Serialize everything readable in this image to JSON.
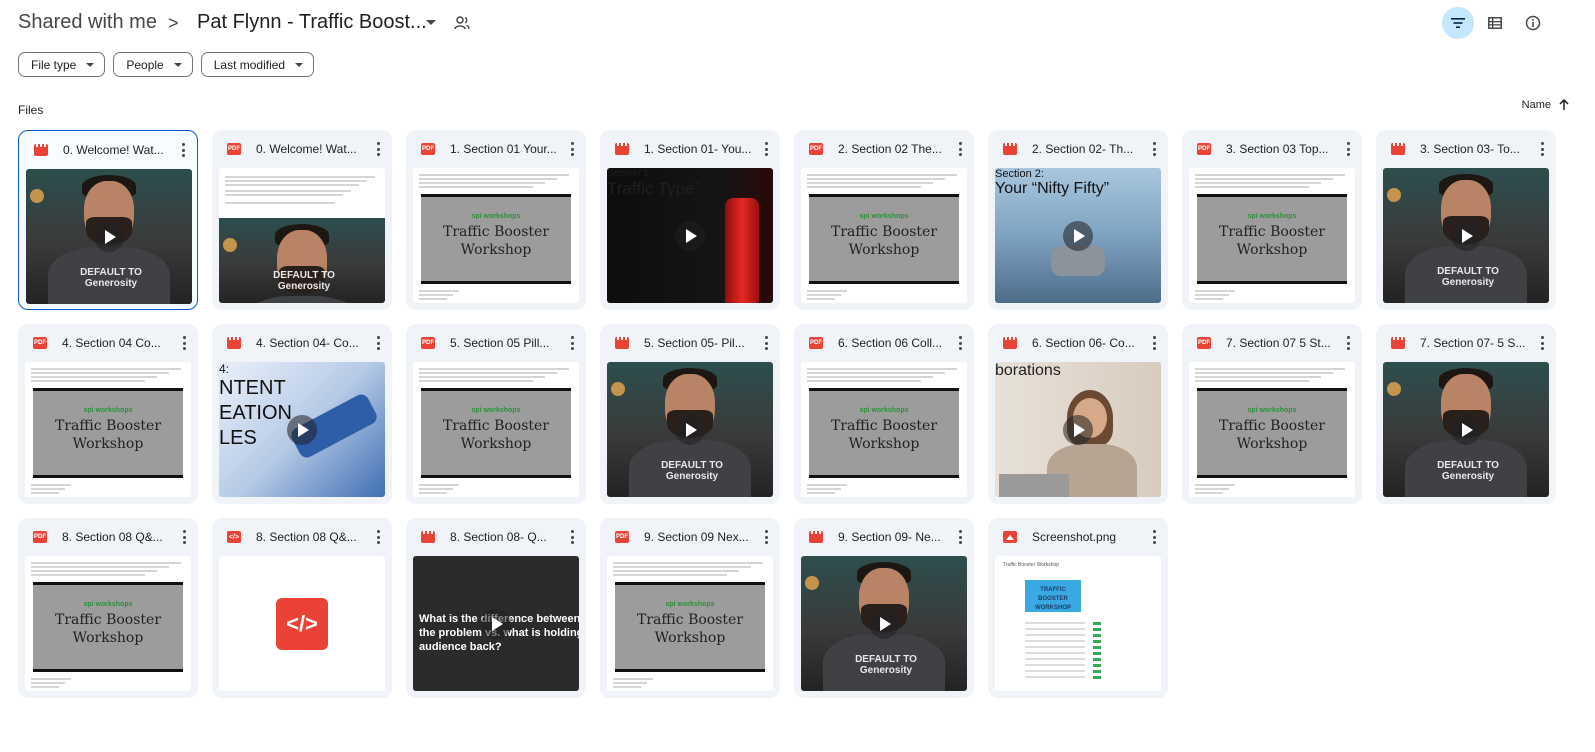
{
  "breadcrumb": {
    "root": "Shared with me",
    "separator": ">",
    "current": "Pat Flynn - Traffic Boost..."
  },
  "toolbar": {
    "filter_icon": "filter-icon",
    "list_view_icon": "list-view-icon",
    "info_icon": "info-icon"
  },
  "filters": [
    {
      "label": "File type"
    },
    {
      "label": "People"
    },
    {
      "label": "Last modified"
    }
  ],
  "files_label": "Files",
  "sort": {
    "label": "Name",
    "direction_icon": "arrow-up-icon"
  },
  "colors": {
    "accent": "#0b57d0",
    "active_bg": "#c2e7ff",
    "card_bg": "#f0f4f9",
    "file_red": "#ea4335"
  },
  "files": [
    {
      "name": "0. Welcome! Wat...",
      "type": "video",
      "thumb": "person",
      "slogan": "DEFAULT TO Generosity"
    },
    {
      "name": "0. Welcome! Wat...",
      "type": "pdf",
      "thumb": "doc-person",
      "slogan": "DEFAULT TO Generosity"
    },
    {
      "name": "1. Section 01 Your...",
      "type": "pdf",
      "thumb": "doc-slide",
      "slide_brand": "spi workshops",
      "slide_title": "Traffic Booster Workshop"
    },
    {
      "name": "1. Section 01- You...",
      "type": "video",
      "thumb": "red",
      "heading": "Section 1:",
      "sub": "Traffic Type”"
    },
    {
      "name": "2. Section 02 The...",
      "type": "pdf",
      "thumb": "doc-slide",
      "slide_brand": "spi workshops",
      "slide_title": "Traffic Booster Workshop"
    },
    {
      "name": "2. Section 02- Th...",
      "type": "video",
      "thumb": "sky",
      "heading": "Section 2:",
      "sub": "Your “Nifty Fifty”"
    },
    {
      "name": "3. Section 03 Top...",
      "type": "pdf",
      "thumb": "doc-slide",
      "slide_brand": "spi workshops",
      "slide_title": "Traffic Booster Workshop"
    },
    {
      "name": "3. Section 03- To...",
      "type": "video",
      "thumb": "person",
      "slogan": "DEFAULT TO Generosity"
    },
    {
      "name": "4. Section 04 Co...",
      "type": "pdf",
      "thumb": "doc-slide",
      "slide_brand": "spi workshops",
      "slide_title": "Traffic Booster Workshop"
    },
    {
      "name": "4. Section 04- Co...",
      "type": "video",
      "thumb": "gavel",
      "heading": "4:",
      "sub": "NTENT EATION LES"
    },
    {
      "name": "5. Section 05 Pill...",
      "type": "pdf",
      "thumb": "doc-slide",
      "slide_brand": "spi workshops",
      "slide_title": "Traffic Booster Workshop"
    },
    {
      "name": "5. Section 05- Pil...",
      "type": "video",
      "thumb": "person",
      "slogan": "DEFAULT TO Generosity"
    },
    {
      "name": "6. Section 06 Coll...",
      "type": "pdf",
      "thumb": "doc-slide",
      "slide_brand": "spi workshops",
      "slide_title": "Traffic Booster Workshop"
    },
    {
      "name": "6. Section 06- Co...",
      "type": "video",
      "thumb": "woman",
      "heading": "borations"
    },
    {
      "name": "7. Section 07 5 St...",
      "type": "pdf",
      "thumb": "doc-slide",
      "slide_brand": "spi workshops",
      "slide_title": "Traffic Booster Workshop"
    },
    {
      "name": "7. Section 07- 5 S...",
      "type": "video",
      "thumb": "person",
      "slogan": "DEFAULT TO Generosity"
    },
    {
      "name": "8. Section 08 Q&...",
      "type": "pdf",
      "thumb": "doc-slide",
      "slide_brand": "spi workshops",
      "slide_title": "Traffic Booster Workshop"
    },
    {
      "name": "8. Section 08 Q&...",
      "type": "code",
      "thumb": "code"
    },
    {
      "name": "8. Section 08- Q...",
      "type": "video",
      "thumb": "dark",
      "heading": "What is the difference between the problem vs. what is holding audience back?"
    },
    {
      "name": "9. Section 09 Nex...",
      "type": "pdf",
      "thumb": "doc-slide",
      "slide_brand": "spi workshops",
      "slide_title": "Traffic Booster Workshop"
    },
    {
      "name": "9. Section 09- Ne...",
      "type": "video",
      "thumb": "person",
      "slogan": "DEFAULT TO Generosity"
    },
    {
      "name": "Screenshot.png",
      "type": "image",
      "thumb": "shot",
      "caption": "Traffic Booster Workshop",
      "hero": "TRAFFIC BOOSTER WORKSHOP"
    }
  ]
}
